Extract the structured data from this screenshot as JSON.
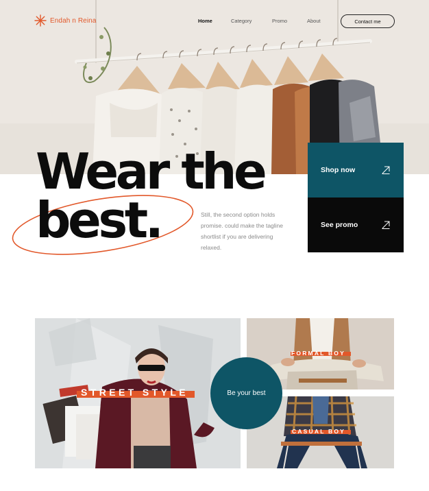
{
  "brand": {
    "name": "Endah n Reina",
    "accent_color": "#e2582a",
    "logo_icon": "asterisk-burst-icon"
  },
  "nav": {
    "items": [
      {
        "label": "Home",
        "active": true
      },
      {
        "label": "Category",
        "active": false
      },
      {
        "label": "Promo",
        "active": false
      },
      {
        "label": "About",
        "active": false
      }
    ],
    "contact_label": "Contact me"
  },
  "hero": {
    "headline_line1": "Wear the",
    "headline_line2": "best.",
    "description": "Still, the second option holds promise. could make the tagline shortlist if you are delivering relaxed.",
    "photo": "clothes-on-rack-photo"
  },
  "cta": {
    "shop": {
      "label": "Shop now",
      "icon": "arrow-up-right-icon",
      "color": "#0e5566"
    },
    "promo": {
      "label": "See promo",
      "icon": "arrow-up-right-icon",
      "color": "#0a0a0a"
    }
  },
  "gallery": {
    "street": {
      "label": "STREET STYLE",
      "photo": "woman-with-shopping-bags-photo"
    },
    "formal": {
      "label": "FORMAL BOY",
      "photo": "seated-man-blazer-photo"
    },
    "casual": {
      "label": "CASUAL BOY",
      "photo": "seated-man-plaid-shirt-photo"
    },
    "center_circle": {
      "label": "Be your best",
      "color": "#0e5566"
    }
  }
}
